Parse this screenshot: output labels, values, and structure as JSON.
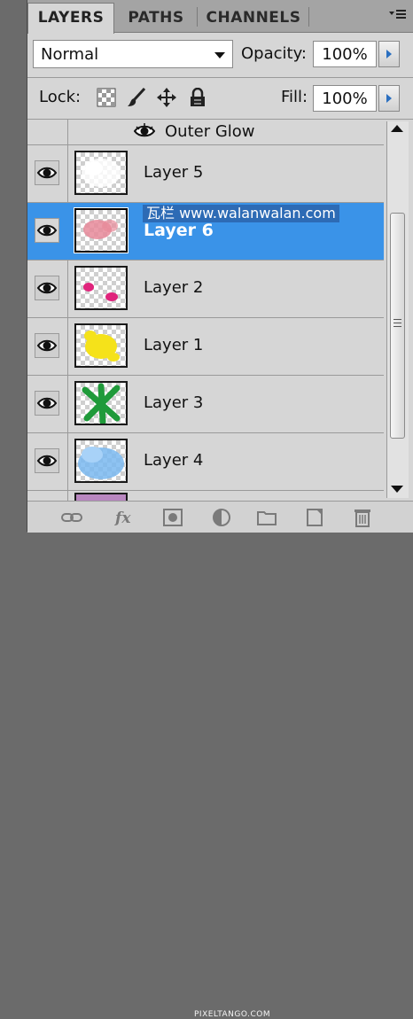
{
  "tabs": [
    {
      "label": "LAYERS",
      "active": true
    },
    {
      "label": "PATHS",
      "active": false
    },
    {
      "label": "CHANNELS",
      "active": false
    }
  ],
  "blend_mode": {
    "value": "Normal"
  },
  "opacity": {
    "label": "Opacity:",
    "value": "100%"
  },
  "lock": {
    "label": "Lock:"
  },
  "fill": {
    "label": "Fill:",
    "value": "100%"
  },
  "effect": {
    "name": "Outer Glow"
  },
  "layers": [
    {
      "name": "Layer 5",
      "selected": false,
      "paint": "white"
    },
    {
      "name": "Layer 6",
      "selected": true,
      "paint": "#e88a9a"
    },
    {
      "name": "Layer 2",
      "selected": false,
      "paint": "#e0247c"
    },
    {
      "name": "Layer 1",
      "selected": false,
      "paint": "#f5e21a"
    },
    {
      "name": "Layer 3",
      "selected": false,
      "paint": "#1f9a3a"
    },
    {
      "name": "Layer 4",
      "selected": false,
      "paint": "#7ab8f0"
    }
  ],
  "colors": {
    "selection": "#3a93e8",
    "panel": "#d6d6d6"
  },
  "watermark": {
    "text": "瓦栏 www.walanwalan.com"
  },
  "footer_watermark": {
    "text": "PIXELTANGO.COM"
  }
}
